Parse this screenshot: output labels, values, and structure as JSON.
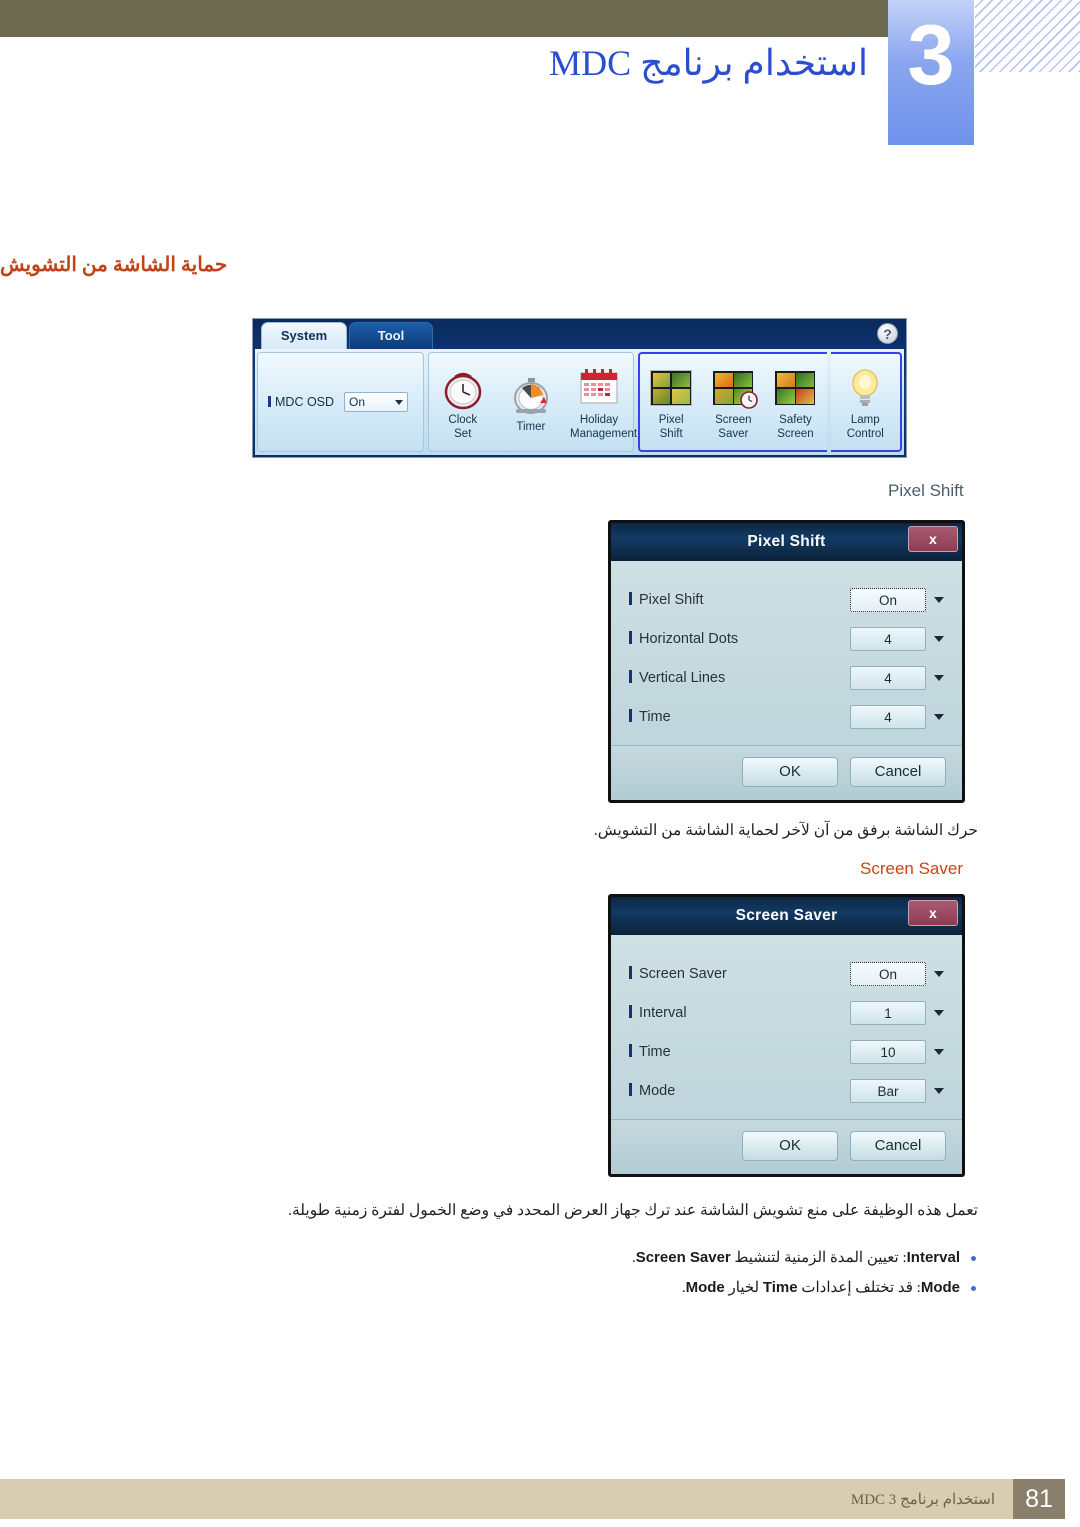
{
  "header": {
    "chapter_number": "3",
    "chapter_title": "استخدام برنامج MDC"
  },
  "section": {
    "heading": "حماية الشاشة من التشويش"
  },
  "toolbar": {
    "tabs": [
      {
        "label": "System",
        "active": true
      },
      {
        "label": "Tool",
        "active": false
      }
    ],
    "help_icon": "?",
    "osd": {
      "label": "MDC OSD",
      "value": "On"
    },
    "groups": [
      {
        "name": "clock-group",
        "items": [
          {
            "icon": "clock-icon",
            "line1": "Clock",
            "line2": "Set"
          },
          {
            "icon": "timer-icon",
            "line1": "Timer",
            "line2": ""
          },
          {
            "icon": "calendar-icon",
            "line1": "Holiday",
            "line2": "Management"
          }
        ]
      },
      {
        "name": "screen-group",
        "items": [
          {
            "icon": "pixel-shift-icon",
            "line1": "Pixel",
            "line2": "Shift"
          },
          {
            "icon": "screen-saver-icon",
            "line1": "Screen",
            "line2": "Saver"
          },
          {
            "icon": "safety-screen-icon",
            "line1": "Safety",
            "line2": "Screen"
          }
        ]
      },
      {
        "name": "lamp-group",
        "items": [
          {
            "icon": "lamp-icon",
            "line1": "Lamp",
            "line2": "Control"
          }
        ]
      }
    ]
  },
  "captions": {
    "pixel_shift": "Pixel Shift",
    "screen_saver": "Screen Saver"
  },
  "pixel_shift_dialog": {
    "title": "Pixel Shift",
    "close_label": "x",
    "rows": [
      {
        "label": "Pixel Shift",
        "value": "On",
        "focused": true
      },
      {
        "label": "Horizontal Dots",
        "value": "4",
        "focused": false
      },
      {
        "label": "Vertical Lines",
        "value": "4",
        "focused": false
      },
      {
        "label": "Time",
        "value": "4",
        "focused": false
      }
    ],
    "ok_label": "OK",
    "cancel_label": "Cancel"
  },
  "pixel_shift_note": "حرك الشاشة برفق من آن لآخر لحماية الشاشة من التشويش.",
  "screen_saver_dialog": {
    "title": "Screen Saver",
    "close_label": "x",
    "rows": [
      {
        "label": "Screen Saver",
        "value": "On",
        "focused": true
      },
      {
        "label": "Interval",
        "value": "1",
        "focused": false
      },
      {
        "label": "Time",
        "value": "10",
        "focused": false
      },
      {
        "label": "Mode",
        "value": "Bar",
        "focused": false
      }
    ],
    "ok_label": "OK",
    "cancel_label": "Cancel"
  },
  "screen_saver_note": "تعمل هذه الوظيفة على منع تشويش الشاشة عند ترك جهاز العرض المحدد في وضع الخمول لفترة زمنية طويلة.",
  "bullets": [
    {
      "term": "Interval",
      "mid": ": تعيين المدة الزمنية لتنشيط ",
      "term2": "Screen Saver",
      "tail": "."
    },
    {
      "term": "Mode",
      "mid": ": قد تختلف إعدادات ",
      "term2": "Time",
      "tail": " لخيار ",
      "term3": "Mode",
      "tail2": "."
    }
  ],
  "footer": {
    "text": "استخدام برنامج MDC 3",
    "page_number": "81"
  }
}
